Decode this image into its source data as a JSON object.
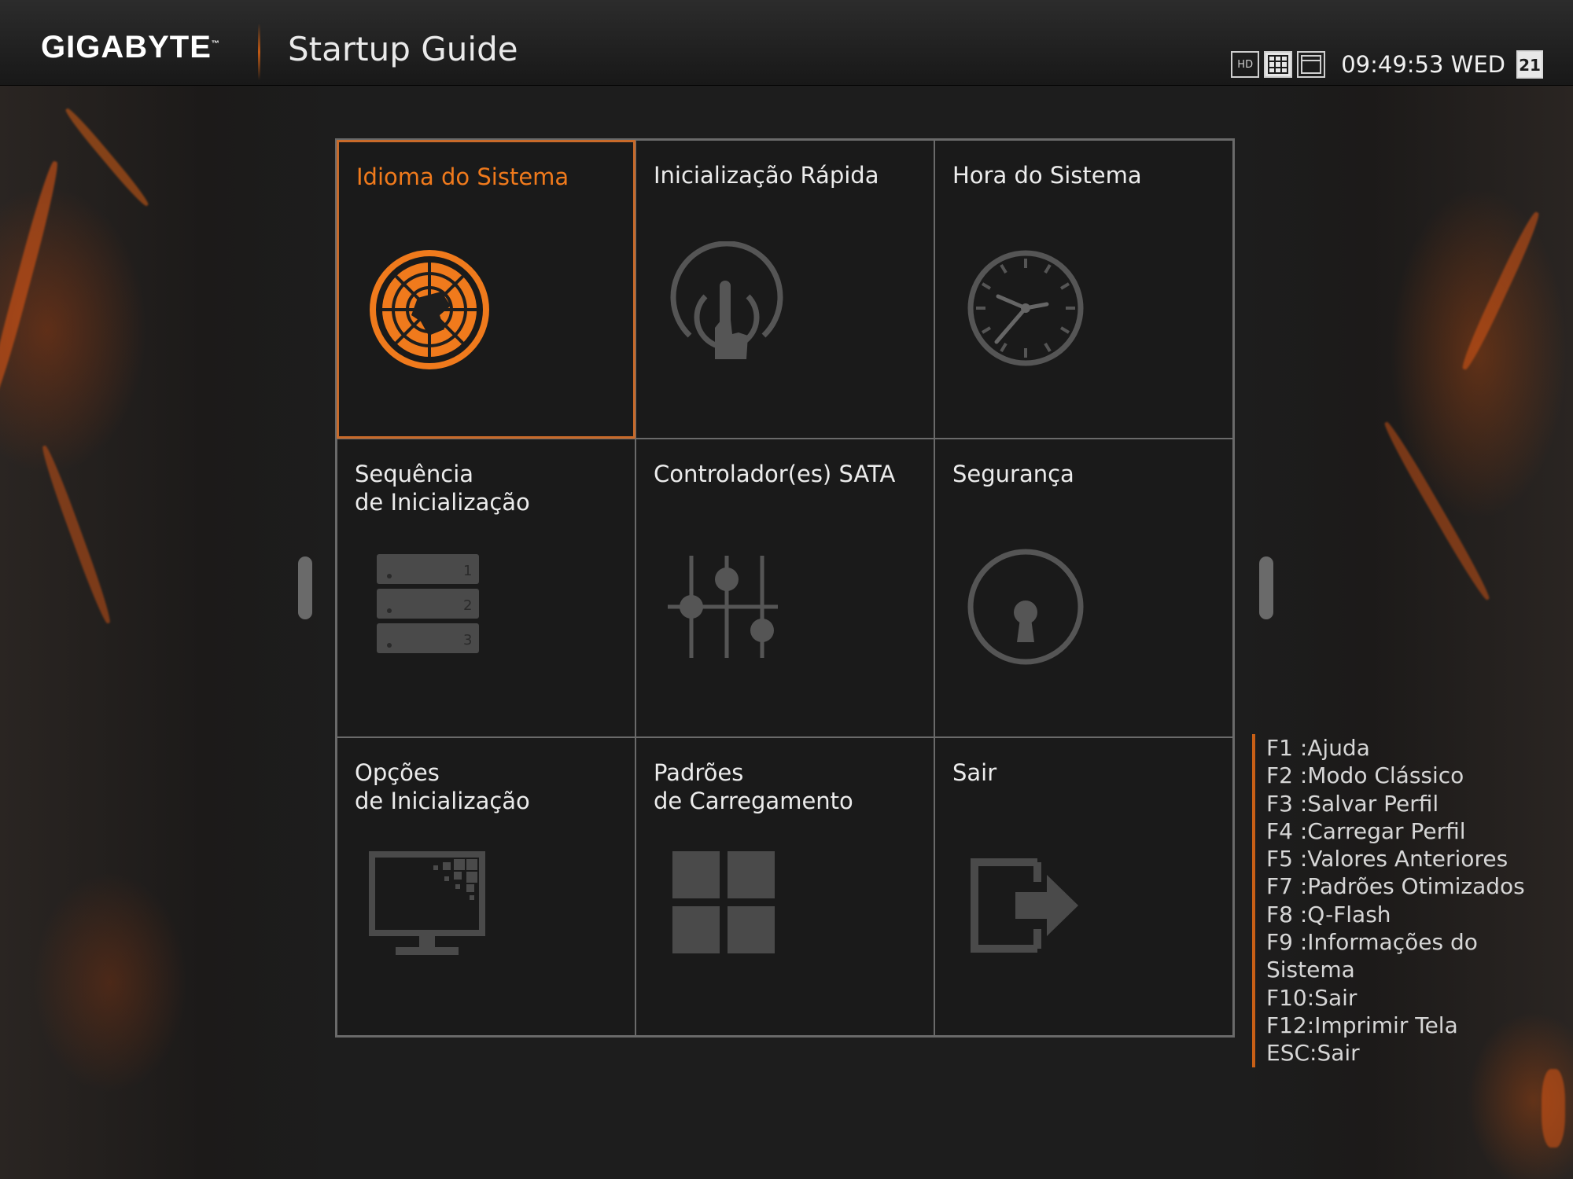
{
  "header": {
    "brand": "GIGABYTE",
    "trademark": "™",
    "title": "Startup Guide",
    "mode_icons": [
      {
        "name": "hd-mode-icon",
        "label": "HD"
      },
      {
        "name": "grid-mode-icon",
        "label": ""
      },
      {
        "name": "window-mode-icon",
        "label": ""
      }
    ],
    "clock": "09:49:53 WED",
    "calendar_day": "21"
  },
  "tiles": [
    {
      "label": "Idioma do Sistema",
      "icon": "globe-icon",
      "selected": true
    },
    {
      "label": "Inicialização Rápida",
      "icon": "power-touch-icon"
    },
    {
      "label": "Hora do Sistema",
      "icon": "clock-icon"
    },
    {
      "label": "Sequência\nde Inicialização",
      "icon": "boot-order-icon"
    },
    {
      "label": "Controlador(es) SATA",
      "icon": "sliders-icon"
    },
    {
      "label": "Segurança",
      "icon": "keyhole-icon"
    },
    {
      "label": "Opções\nde Inicialização",
      "icon": "monitor-icon"
    },
    {
      "label": "Padrões\nde Carregamento",
      "icon": "windows-grid-icon"
    },
    {
      "label": "Sair",
      "icon": "exit-icon"
    }
  ],
  "hotkeys": [
    "F1 :Ajuda",
    "F2 :Modo Clássico",
    "F3 :Salvar Perfil",
    "F4 :Carregar Perfil",
    "F5 :Valores Anteriores",
    "F7 :Padrões Otimizados",
    "F8 :Q-Flash",
    "F9 :Informações do",
    "Sistema",
    "F10:Sair",
    "F12:Imprimir Tela",
    "ESC:Sair"
  ],
  "colors": {
    "accent": "#f07a1c",
    "icon_gray": "#5a5a5a",
    "border": "#6a6a6a"
  }
}
